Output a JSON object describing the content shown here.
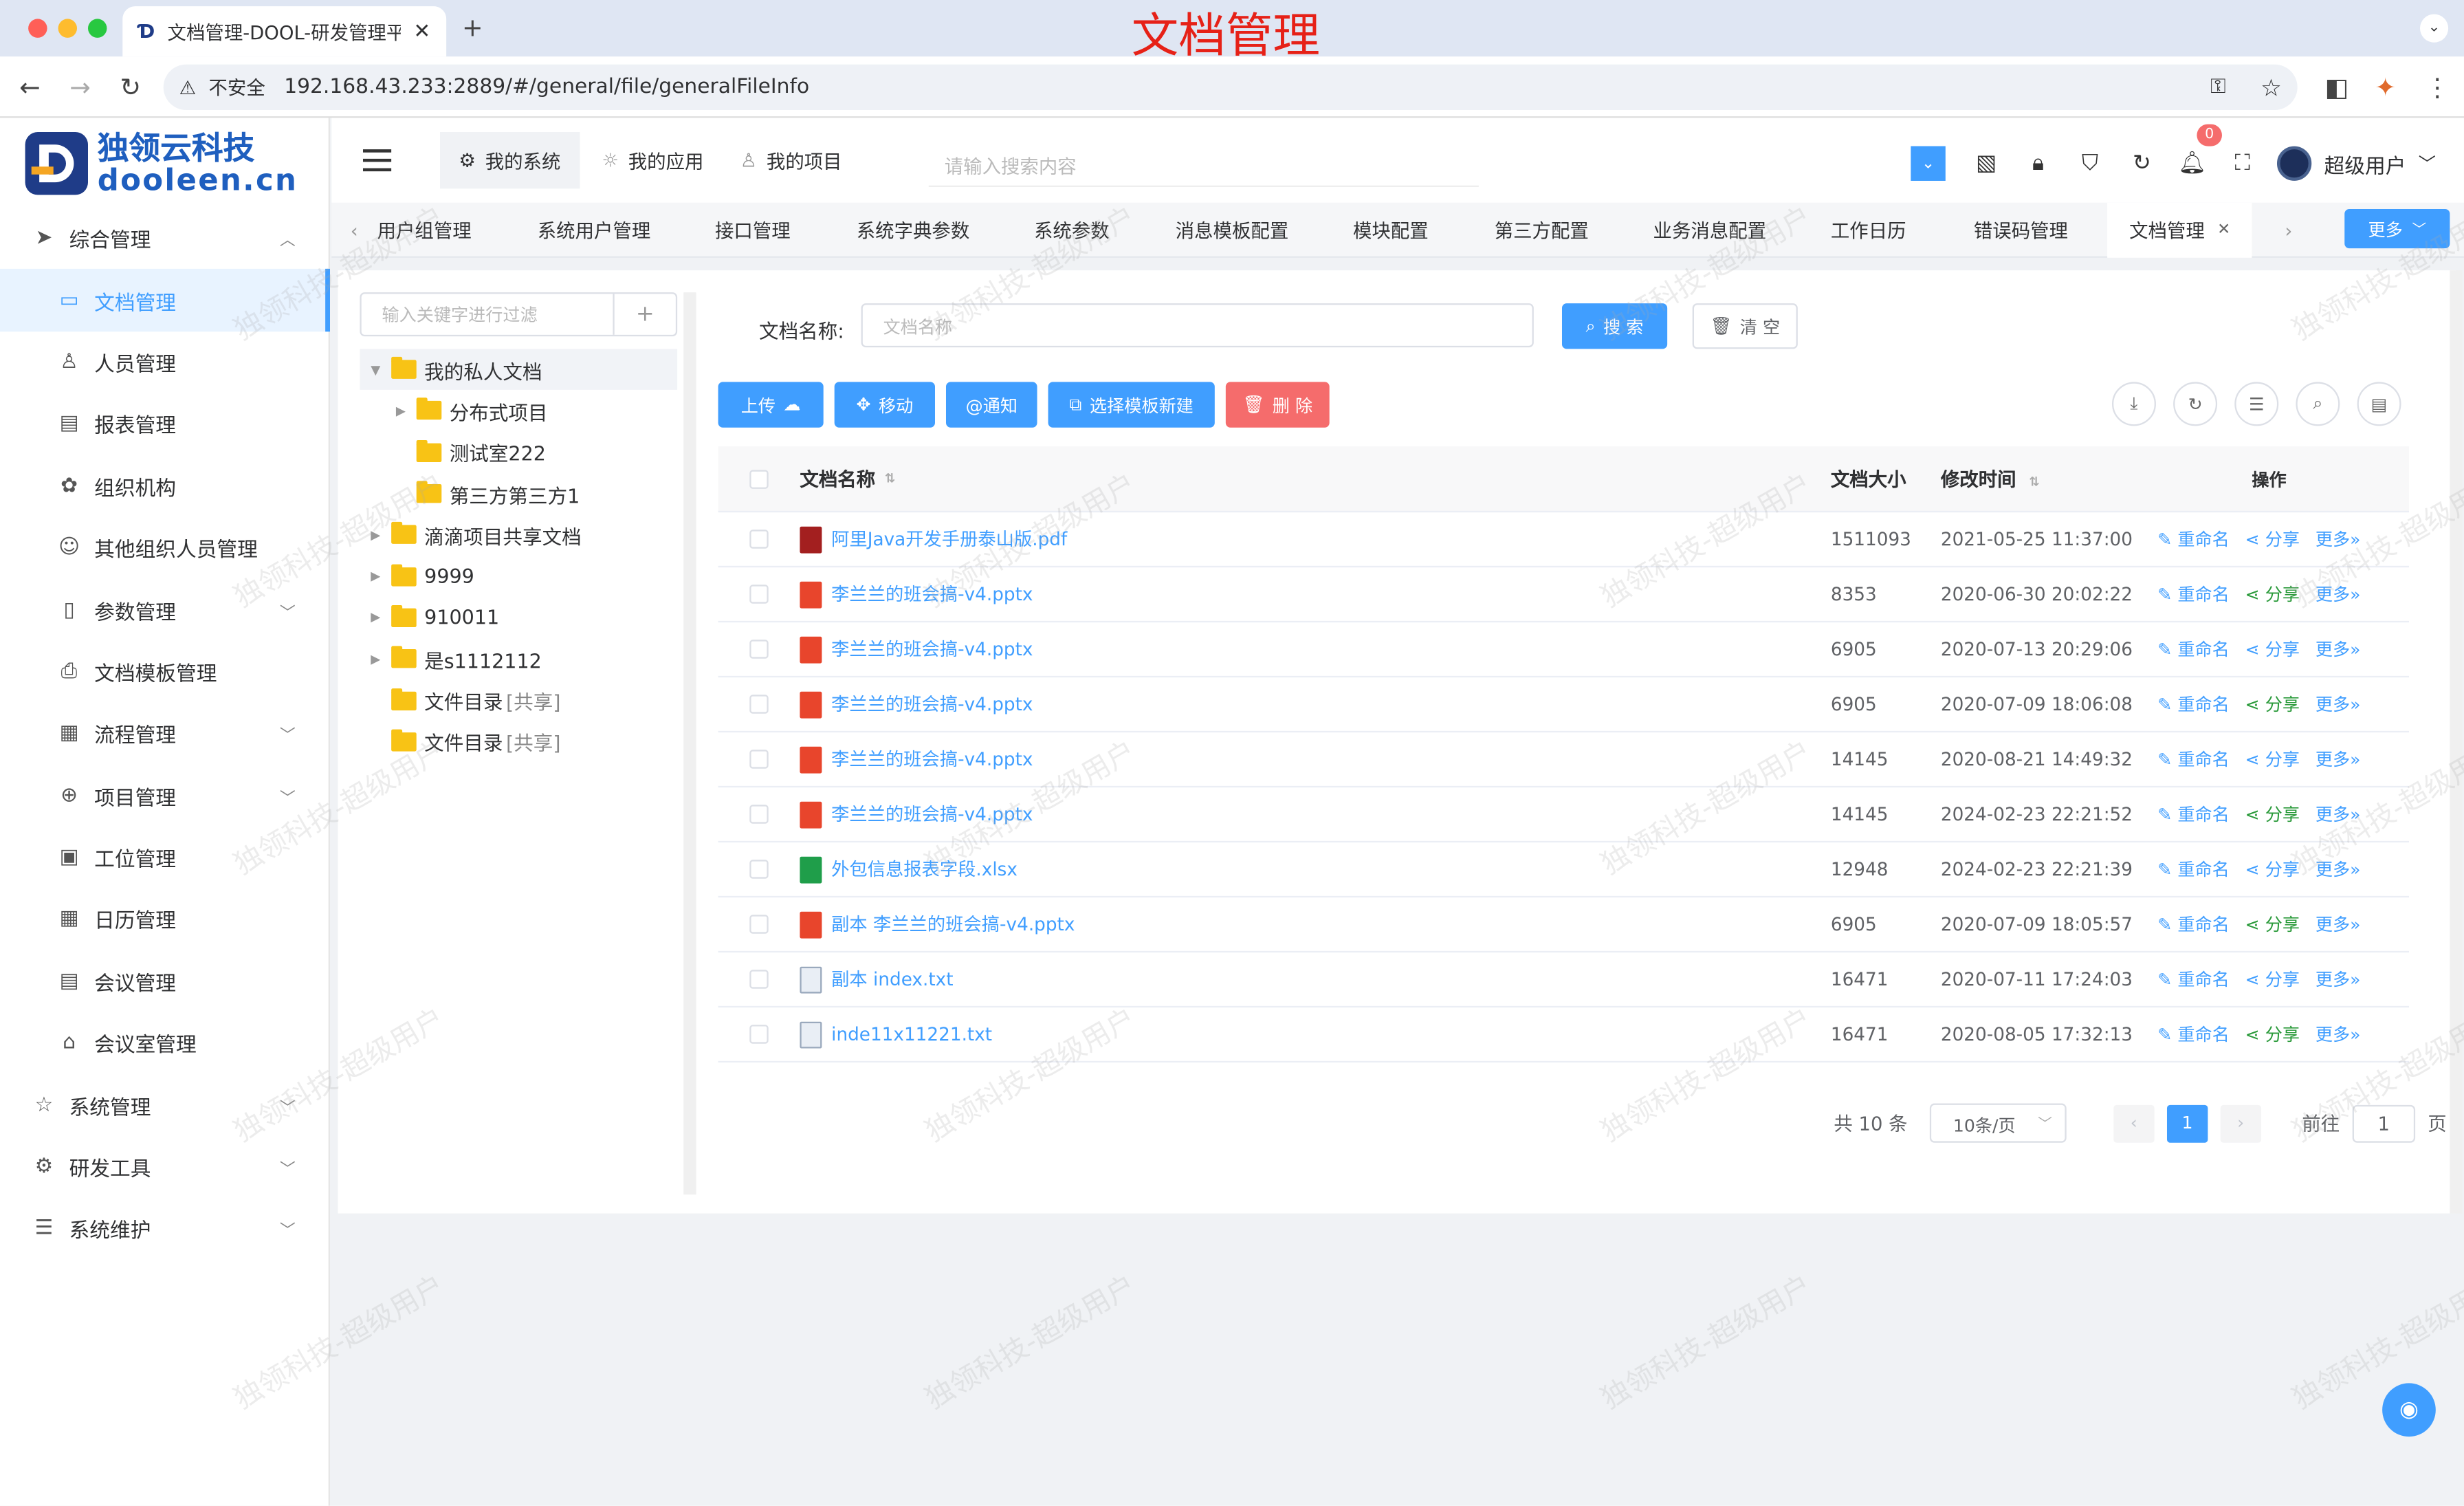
{
  "browser": {
    "tab_title": "文档管理-DOOL-研发管理平台",
    "url_security": "不安全",
    "url": "192.168.43.233:2889/#/general/file/generalFileInfo",
    "overlay_caption": "文档管理"
  },
  "logo": {
    "name": "独领云科技",
    "domain": "dooleen.cn"
  },
  "sidebar": {
    "groups": [
      {
        "label": "综合管理",
        "icon": "paper-plane-icon",
        "expanded": true
      },
      {
        "label": "系统管理",
        "icon": "star-icon"
      },
      {
        "label": "研发工具",
        "icon": "gear-icon"
      },
      {
        "label": "系统维护",
        "icon": "sliders-icon"
      }
    ],
    "items": [
      {
        "label": "文档管理",
        "icon": "folder-icon",
        "active": true
      },
      {
        "label": "人员管理",
        "icon": "user-icon"
      },
      {
        "label": "报表管理",
        "icon": "report-icon"
      },
      {
        "label": "组织机构",
        "icon": "cog-icon"
      },
      {
        "label": "其他组织人员管理",
        "icon": "smile-icon"
      },
      {
        "label": "参数管理",
        "icon": "notebook-icon"
      },
      {
        "label": "文档模板管理",
        "icon": "printer-icon"
      },
      {
        "label": "流程管理",
        "icon": "calendar-icon"
      },
      {
        "label": "项目管理",
        "icon": "plus-circle-icon"
      },
      {
        "label": "工位管理",
        "icon": "clipboard-icon"
      },
      {
        "label": "日历管理",
        "icon": "date-icon"
      },
      {
        "label": "会议管理",
        "icon": "document-icon"
      },
      {
        "label": "会议室管理",
        "icon": "house-icon"
      }
    ]
  },
  "header": {
    "tabs": [
      {
        "label": "我的系统",
        "icon": "gear-icon",
        "active": true
      },
      {
        "label": "我的应用",
        "icon": "sun-icon"
      },
      {
        "label": "我的项目",
        "icon": "user-icon"
      }
    ],
    "search_placeholder": "请输入搜索内容",
    "notification_count": "0",
    "username": "超级用户"
  },
  "tags": [
    "用户组管理",
    "系统用户管理",
    "接口管理",
    "系统字典参数",
    "系统参数",
    "消息模板配置",
    "模块配置",
    "第三方配置",
    "业务消息配置",
    "工作日历",
    "错误码管理",
    "文档管理"
  ],
  "tags_more": "更多",
  "tree": {
    "filter_placeholder": "输入关键字进行过滤",
    "nodes": [
      {
        "label": "我的私人文档",
        "level": 0,
        "expanded": true
      },
      {
        "label": "分布式项目",
        "level": 1,
        "has_children": true
      },
      {
        "label": "测试室222",
        "level": 1
      },
      {
        "label": "第三方第三方1",
        "level": 1
      },
      {
        "label": "滴滴项目共享文档",
        "level": 0,
        "has_children": true
      },
      {
        "label": "9999",
        "level": 0,
        "has_children": true
      },
      {
        "label": "910011",
        "level": 0,
        "has_children": true
      },
      {
        "label": "是s1112112",
        "level": 0,
        "has_children": true
      },
      {
        "label": "文件目录",
        "level": 0,
        "suffix": "[共享]"
      },
      {
        "label": "文件目录",
        "level": 0,
        "suffix": "[共享]"
      }
    ]
  },
  "search": {
    "label": "文档名称:",
    "placeholder": "文档名称",
    "search_btn": "搜 索",
    "clear_btn": "清 空"
  },
  "toolbar": {
    "upload": "上传",
    "move": "移动",
    "notify": "@通知",
    "template_new": "选择模板新建",
    "delete": "删 除"
  },
  "table": {
    "headers": {
      "name": "文档名称",
      "size": "文档大小",
      "time": "修改时间",
      "ops": "操作"
    },
    "op_labels": {
      "rename": "重命名",
      "share": "分享",
      "more": "更多"
    },
    "rows": [
      {
        "name": "阿里Java开发手册泰山版.pdf",
        "type": "pdf",
        "size": "1511093",
        "time": "2021-05-25 11:37:00"
      },
      {
        "name": "李兰兰的班会搞-v4.pptx",
        "type": "ppt",
        "size": "8353",
        "time": "2020-06-30 20:02:22"
      },
      {
        "name": "李兰兰的班会搞-v4.pptx",
        "type": "ppt",
        "size": "6905",
        "time": "2020-07-13 20:29:06"
      },
      {
        "name": "李兰兰的班会搞-v4.pptx",
        "type": "ppt",
        "size": "6905",
        "time": "2020-07-09 18:06:08"
      },
      {
        "name": "李兰兰的班会搞-v4.pptx",
        "type": "ppt",
        "size": "14145",
        "time": "2020-08-21 14:49:32"
      },
      {
        "name": "李兰兰的班会搞-v4.pptx",
        "type": "ppt",
        "size": "14145",
        "time": "2024-02-23 22:21:52"
      },
      {
        "name": "外包信息报表字段.xlsx",
        "type": "xls",
        "size": "12948",
        "time": "2024-02-23 22:21:39"
      },
      {
        "name": "副本 李兰兰的班会搞-v4.pptx",
        "type": "ppt",
        "size": "6905",
        "time": "2020-07-09 18:05:57"
      },
      {
        "name": "副本 index.txt",
        "type": "txt",
        "size": "16471",
        "time": "2020-07-11 17:24:03"
      },
      {
        "name": "inde11x11221.txt",
        "type": "txt",
        "size": "16471",
        "time": "2020-08-05 17:32:13"
      }
    ]
  },
  "pagination": {
    "total": "共 10 条",
    "page_size": "10条/页",
    "current": "1",
    "goto_label": "前往",
    "goto_value": "1",
    "page_suffix": "页"
  },
  "watermark": "独领科技-超级用户",
  "colors": {
    "primary": "#409eff",
    "danger": "#f56c6c",
    "folder": "#f8c315"
  }
}
